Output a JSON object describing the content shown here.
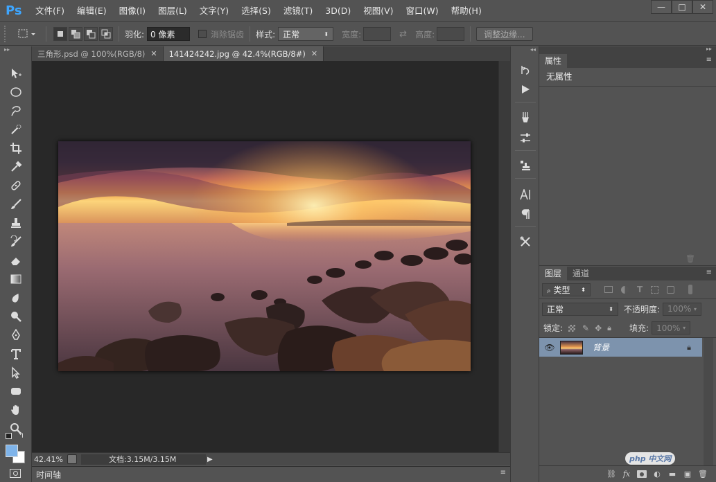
{
  "app": {
    "logo": "Ps",
    "menu": [
      "文件(F)",
      "编辑(E)",
      "图像(I)",
      "图层(L)",
      "文字(Y)",
      "选择(S)",
      "滤镜(T)",
      "3D(D)",
      "视图(V)",
      "窗口(W)",
      "帮助(H)"
    ],
    "window_controls": [
      "—",
      "□",
      "✕"
    ]
  },
  "options_bar": {
    "feather_label": "羽化:",
    "feather_value": "0 像素",
    "antialias_label": "消除锯齿",
    "style_label": "样式:",
    "style_value": "正常",
    "width_label": "宽度:",
    "height_label": "高度:",
    "refine_edge_label": "调整边缘..."
  },
  "tabs": [
    {
      "label": "三角形.psd @ 100%(RGB/8)",
      "close": "✕"
    },
    {
      "label": "141424242.jpg @ 42.4%(RGB/8#)",
      "close": "✕"
    }
  ],
  "status": {
    "zoom": "42.41%",
    "doc_size": "文档:3.15M/3.15M"
  },
  "timeline": {
    "label": "时间轴"
  },
  "properties_panel": {
    "tab": "属性",
    "content": "无属性"
  },
  "layers_panel": {
    "tabs": [
      "图层",
      "通道"
    ],
    "filter_kind": "类型",
    "blend_mode": "正常",
    "opacity_label": "不透明度:",
    "opacity_value": "100%",
    "lock_label": "锁定:",
    "fill_label": "填充:",
    "fill_value": "100%",
    "layers": [
      {
        "name": "背景",
        "visible": true,
        "locked": true
      }
    ]
  },
  "colors": {
    "foreground": "#7fb4ea",
    "background": "#ffffff",
    "selected_layer": "#7d93ad",
    "logo": "#3ea6ff"
  },
  "watermark": "php 中文网"
}
